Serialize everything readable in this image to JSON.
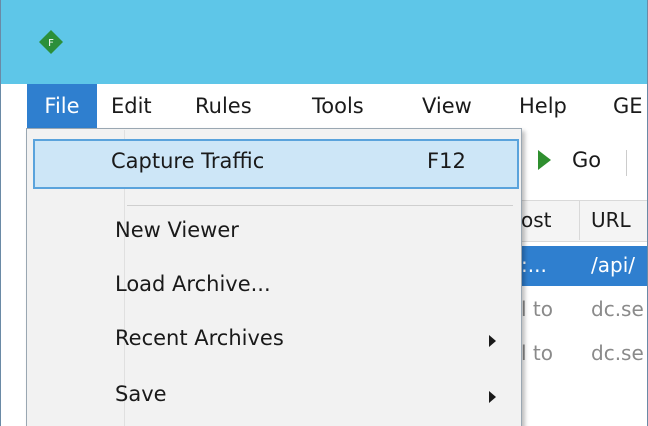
{
  "app": {
    "logo_letter": "F",
    "logo_color": "#2b8f3a",
    "titlebar_color": "#5ec6e8",
    "accent": "#2f7fcf"
  },
  "menubar": {
    "items": [
      {
        "label": "File",
        "active": true
      },
      {
        "label": "Edit"
      },
      {
        "label": "Rules"
      },
      {
        "label": "Tools"
      },
      {
        "label": "View"
      },
      {
        "label": "Help"
      },
      {
        "label": "GE"
      }
    ]
  },
  "toolbar": {
    "go_label": "Go",
    "go_icon": "play-arrow-icon"
  },
  "grid": {
    "headers": [
      "ost",
      "URL"
    ],
    "rows": [
      {
        "host": ":...",
        "url": "/api/",
        "selected": true
      },
      {
        "host": "l to",
        "url": "dc.se"
      },
      {
        "host": "l to",
        "url": "dc.se"
      }
    ]
  },
  "file_menu": {
    "items": [
      {
        "label": "Capture Traffic",
        "shortcut": "F12",
        "highlighted": true
      },
      {
        "label": "New Viewer"
      },
      {
        "label": "Load Archive..."
      },
      {
        "label": "Recent Archives",
        "submenu": true
      },
      {
        "label": "Save",
        "submenu": true
      }
    ]
  }
}
